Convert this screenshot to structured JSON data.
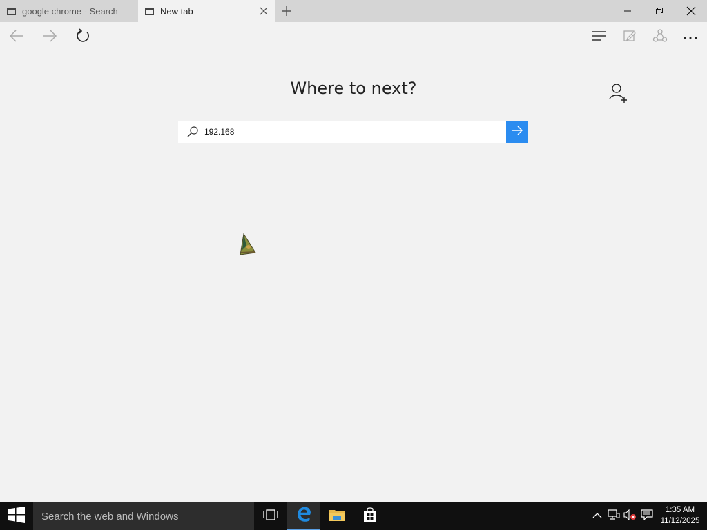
{
  "tabs": [
    {
      "label": "google chrome - Search",
      "active": false
    },
    {
      "label": "New tab",
      "active": true
    }
  ],
  "toolbar": {
    "icons": [
      "back-icon",
      "forward-icon",
      "refresh-icon",
      "hub-icon",
      "web-note-icon",
      "share-icon",
      "more-icon"
    ]
  },
  "window_controls": [
    "minimize-icon",
    "restore-icon",
    "close-icon"
  ],
  "newtab": {
    "heading": "Where to next?",
    "search_value": "192.168",
    "go_icon": "arrow-right-icon",
    "add_person_icon": "add-person-icon"
  },
  "taskbar": {
    "search_placeholder": "Search the web and Windows",
    "apps": [
      "task-view-icon",
      "edge-icon",
      "file-explorer-icon",
      "store-icon"
    ],
    "tray": [
      "chevron-up-icon",
      "network-icon",
      "volume-muted-icon",
      "action-center-icon"
    ],
    "time": "1:35 AM",
    "date": "11/12/2025"
  },
  "colors": {
    "accent": "#2b8cf0",
    "taskbar": "#101010",
    "tabbar": "#d5d5d5",
    "page": "#f2f2f2"
  }
}
